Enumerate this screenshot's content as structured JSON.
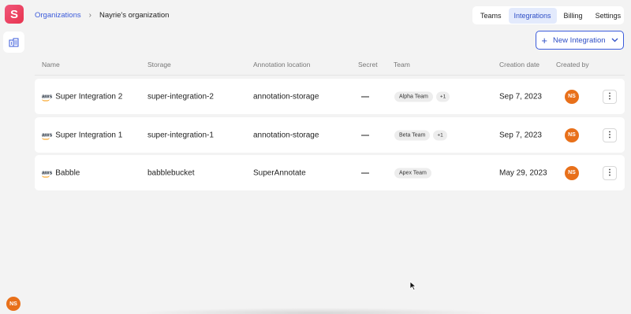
{
  "app": {
    "logo_letter": "S"
  },
  "rail": {
    "avatar_initials": "NS"
  },
  "breadcrumb": {
    "root": "Organizations",
    "separator": "›",
    "current": "Nayrie's organization"
  },
  "nav": {
    "tabs": [
      {
        "label": "Teams",
        "active": false
      },
      {
        "label": "Integrations",
        "active": true
      },
      {
        "label": "Billing",
        "active": false
      },
      {
        "label": "Settings",
        "active": false
      }
    ]
  },
  "actions": {
    "new_integration_label": "New Integration"
  },
  "table": {
    "columns": [
      "Name",
      "Storage",
      "Annotation location",
      "Secret",
      "Team",
      "Creation date",
      "Created by"
    ],
    "rows": [
      {
        "provider": "aws",
        "name": "Super Integration 2",
        "storage": "super-integration-2",
        "annotation_location": "annotation-storage",
        "secret": "—",
        "team": "Alpha Team",
        "team_more": "+1",
        "creation_date": "Sep 7, 2023",
        "created_by": "NS"
      },
      {
        "provider": "aws",
        "name": "Super Integration 1",
        "storage": "super-integration-1",
        "annotation_location": "annotation-storage",
        "secret": "—",
        "team": "Beta Team",
        "team_more": "+1",
        "creation_date": "Sep 7, 2023",
        "created_by": "NS"
      },
      {
        "provider": "aws",
        "name": "Babble",
        "storage": "babblebucket",
        "annotation_location": "SuperAnnotate",
        "secret": "—",
        "team": "Apex Team",
        "team_more": "",
        "creation_date": "May 29, 2023",
        "created_by": "NS"
      }
    ]
  },
  "colors": {
    "accent": "#3b5bdb",
    "avatar": "#e8701a",
    "brand": "#e8344f"
  },
  "icons": {
    "rail_button": "building-icon",
    "new_button": "plus-icon",
    "menu": "more-vertical-icon"
  }
}
